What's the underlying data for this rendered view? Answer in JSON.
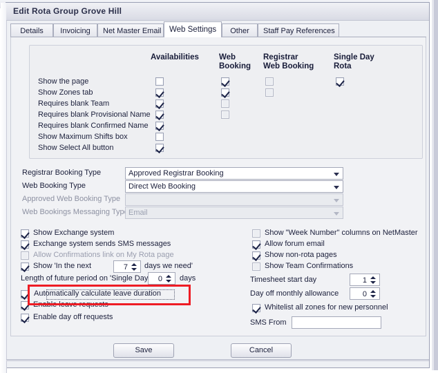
{
  "window": {
    "title": "Edit Rota Group Grove Hill"
  },
  "tabs": [
    {
      "label": "Details",
      "active": false
    },
    {
      "label": "Invoicing",
      "active": false
    },
    {
      "label": "Net Master Email",
      "active": false
    },
    {
      "label": "Web Settings",
      "active": true
    },
    {
      "label": "Other",
      "active": false
    },
    {
      "label": "Staff Pay References",
      "active": false
    }
  ],
  "grid": {
    "columns": [
      {
        "label": "Availabilities",
        "line2": ""
      },
      {
        "label": "Web",
        "line2": "Booking"
      },
      {
        "label": "Registrar",
        "line2": "Web Booking"
      },
      {
        "label": "Single Day",
        "line2": "Rota"
      }
    ],
    "rows": [
      {
        "label": "Show the page",
        "availabilities": false,
        "web_booking": true,
        "registrar_web_booking": false,
        "single_day_rota": true
      },
      {
        "label": "Show Zones tab",
        "availabilities": true,
        "web_booking": true,
        "registrar_web_booking": false,
        "single_day_rota": null
      },
      {
        "label": "Requires blank Team",
        "availabilities": true,
        "web_booking": false,
        "registrar_web_booking": null,
        "single_day_rota": null
      },
      {
        "label": "Requires blank Provisional  Name",
        "availabilities": true,
        "web_booking": false,
        "registrar_web_booking": null,
        "single_day_rota": null
      },
      {
        "label": "Requires blank Confirmed Name",
        "availabilities": true,
        "web_booking": null,
        "registrar_web_booking": null,
        "single_day_rota": null
      },
      {
        "label": "Show Maximum Shifts box",
        "availabilities": false,
        "web_booking": null,
        "registrar_web_booking": null,
        "single_day_rota": null
      },
      {
        "label": "Show Select All button",
        "availabilities": true,
        "web_booking": null,
        "registrar_web_booking": null,
        "single_day_rota": null
      }
    ]
  },
  "combos": [
    {
      "label": "Registrar Booking Type",
      "value": "Approved Registrar Booking",
      "placeholder": "",
      "disabled": false
    },
    {
      "label": "Web Booking Type",
      "value": "Direct Web Booking",
      "placeholder": "",
      "disabled": false
    },
    {
      "label": "Approved Web Booking Type",
      "value": "",
      "placeholder": "",
      "disabled": true
    },
    {
      "label": "Web Bookings Messaging Type",
      "value": "Email",
      "placeholder": "",
      "disabled": true
    }
  ],
  "left_options": {
    "checks": [
      {
        "label": "Show Exchange system",
        "checked": true,
        "dim": false
      },
      {
        "label": "Exchange system sends SMS messages",
        "checked": true,
        "dim": false
      },
      {
        "label": "Allow Confirmations link on My Rota page",
        "checked": false,
        "dim": true
      }
    ],
    "in_the_next": {
      "checked": true,
      "prefix": "Show 'In the next",
      "value": "7",
      "suffix": "days we need'"
    },
    "future_period": {
      "prefix": "Length of future period on 'Single Day",
      "value": "0",
      "suffix": "days"
    },
    "highlighted": {
      "label": "Automatically calculate leave duration",
      "checked": true
    },
    "after": [
      {
        "label": "Enable leave requests",
        "checked": true
      },
      {
        "label": "Enable day off requests",
        "checked": true
      }
    ]
  },
  "right_options": {
    "checks": [
      {
        "label": "Show \"Week Number\" columns on NetMaster",
        "checked": false
      },
      {
        "label": "Allow forum email",
        "checked": true
      },
      {
        "label": "Show non-rota pages",
        "checked": true
      },
      {
        "label": "Show Team Confirmations",
        "checked": false
      }
    ],
    "spinners": [
      {
        "label": "Timesheet start day",
        "value": "1"
      },
      {
        "label": "Day off monthly allowance",
        "value": "0"
      }
    ],
    "whitelist": {
      "label": "Whitelist all zones for new personnel",
      "checked": true
    },
    "sms_from": {
      "label": "SMS From",
      "value": "",
      "placeholder": ""
    }
  },
  "footer": {
    "save_label": "Save",
    "cancel_label": "Cancel"
  },
  "colors": {
    "highlight": "#ee1c24",
    "dialog_bg": "#eef0f4",
    "pane_bg": "#f1f2f5"
  }
}
